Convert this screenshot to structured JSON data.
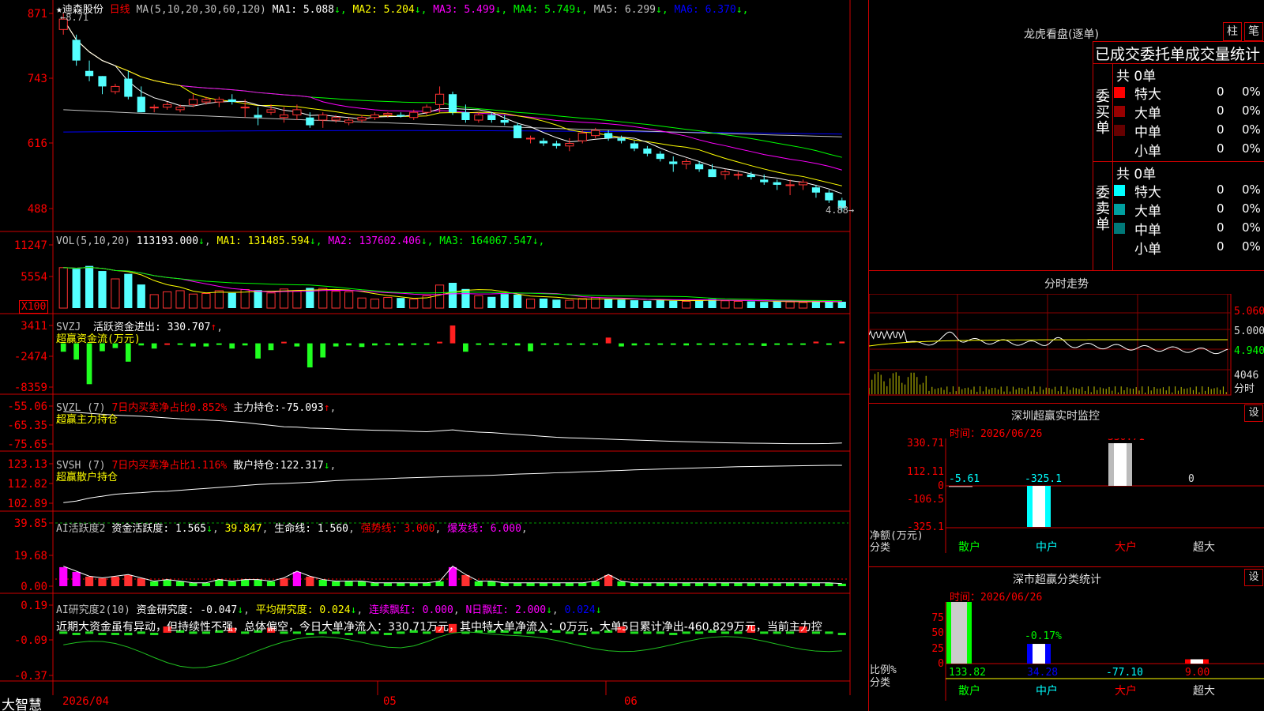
{
  "stock": {
    "star": "★",
    "name": "迪森股份",
    "period": "日线"
  },
  "ma_line": {
    "title": "MA(5,10,20,30,60,120)",
    "items": [
      {
        "label": "MA1:",
        "value": "5.088",
        "arrow": "↓",
        "color": "#ffffff"
      },
      {
        "label": "MA2:",
        "value": "5.204",
        "arrow": "↓",
        "color": "#ffff00"
      },
      {
        "label": "MA3:",
        "value": "5.499",
        "arrow": "↓",
        "color": "#ff00ff"
      },
      {
        "label": "MA4:",
        "value": "5.749",
        "arrow": "↓",
        "color": "#00ff00"
      },
      {
        "label": "MA5:",
        "value": "6.299",
        "arrow": "↓",
        "color": "#c0c0c0"
      },
      {
        "label": "MA6:",
        "value": "6.370",
        "arrow": "↓",
        "color": "#0000ff"
      }
    ]
  },
  "price_axis": [
    "871",
    "743",
    "616",
    "488"
  ],
  "price_high": "8.71",
  "price_low": "4.88",
  "vol": {
    "title": "VOL(5,10,20)",
    "value": "113193.000",
    "arrow": "↓",
    "items": [
      {
        "label": "MA1:",
        "value": "131485.594",
        "arrow": "↓",
        "color": "#ffff00"
      },
      {
        "label": "MA2:",
        "value": "137602.406",
        "arrow": "↓",
        "color": "#ff00ff"
      },
      {
        "label": "MA3:",
        "value": "164067.547",
        "arrow": "↓",
        "color": "#00ff00"
      }
    ],
    "axis": [
      "11247",
      "5554"
    ],
    "unit": "X100"
  },
  "svzj": {
    "name": "SVZJ",
    "label": "活跃资金进出:",
    "value": "330.707",
    "arrow": "↑",
    "sub": "超赢资金流(万元)",
    "axis": [
      "3411",
      "-2474",
      "-8359"
    ]
  },
  "svzl": {
    "name": "SVZL (7)",
    "label": "7日内买卖净占比0.852%",
    "label2": "主力持仓:",
    "value": "-75.093",
    "arrow": "↑",
    "sub": "超赢主力持仓",
    "axis": [
      "-55.06",
      "-65.35",
      "-75.65"
    ]
  },
  "svsh": {
    "name": "SVSH (7)",
    "label": "7日内买卖净占比1.116%",
    "label2": "散户持仓:",
    "value": "122.317",
    "arrow": "↓",
    "sub": "超赢散户持仓",
    "axis": [
      "123.13",
      "112.82",
      "102.89"
    ]
  },
  "ai_active": {
    "name": "AI活跃度2",
    "label": "资金活跃度:",
    "value": "1.565",
    "arrow": "↓",
    "v2": "39.847",
    "label3": "生命线:",
    "v3": "1.560",
    "label4": "强势线:",
    "v4": "3.000",
    "label5": "爆发线:",
    "v5": "6.000",
    "axis": [
      "39.85",
      "19.68",
      "0.00"
    ]
  },
  "ai_research": {
    "name": "AI研究度2(10)",
    "label": "资金研究度:",
    "value": "-0.047",
    "arrow": "↓",
    "label2": "平均研究度:",
    "v2": "0.024",
    "label3": "连续飘红:",
    "v3": "0.000",
    "label4": "N日飘红:",
    "v4": "2.000",
    "v5": "0.024",
    "text": "近期大资金虽有异动，但持续性不强，总体偏空，今日大单净流入：330.71万元，其中特大单净流入：0万元，大单5日累计净出-460.829万元，当前主力控",
    "axis": [
      "0.19",
      "-0.09",
      "-0.37"
    ]
  },
  "x_axis": [
    "2026/04",
    "05",
    "06"
  ],
  "footer_logo": "大智慧",
  "right": {
    "title": "龙虎看盘(逐单)",
    "btn_a": "柱",
    "btn_b": "笔",
    "header": "已成交委托单成交量统计",
    "buy": {
      "label": "委买单",
      "total": "共 0单",
      "rows": [
        {
          "color": "#ff0000",
          "name": "特大",
          "count": "0",
          "pct": "0%"
        },
        {
          "color": "#990000",
          "name": "大单",
          "count": "0",
          "pct": "0%"
        },
        {
          "color": "#660000",
          "name": "中单",
          "count": "0",
          "pct": "0%"
        },
        {
          "color": "",
          "name": "小单",
          "count": "0",
          "pct": "0%"
        }
      ]
    },
    "sell": {
      "label": "委卖单",
      "total": "共 0单",
      "rows": [
        {
          "color": "#00ffff",
          "name": "特大",
          "count": "0",
          "pct": "0%"
        },
        {
          "color": "#00a0a0",
          "name": "大单",
          "count": "0",
          "pct": "0%"
        },
        {
          "color": "#007878",
          "name": "中单",
          "count": "0",
          "pct": "0%"
        },
        {
          "color": "",
          "name": "小单",
          "count": "0",
          "pct": "0%"
        }
      ]
    },
    "intraday": {
      "title": "分时走势",
      "axis": [
        "5.060",
        "5.000",
        "4.940"
      ],
      "vol": "4046",
      "vol_label": "分时"
    },
    "monitor": {
      "title": "深圳超赢实时监控",
      "btn": "设",
      "time_label": "时间：",
      "time": "2026/06/26",
      "axis": [
        "330.71",
        "112.11",
        "0",
        "-106.5",
        "-325.1"
      ],
      "ylabel": "净额(万元)",
      "xlabel": "分类",
      "categories": [
        "散户",
        "中户",
        "大户",
        "超大"
      ],
      "values": [
        "-5.61",
        "-325.1",
        "330.71",
        "0"
      ]
    },
    "classify": {
      "title": "深市超赢分类统计",
      "btn": "设",
      "time_label": "时间：",
      "time": "2026/06/26",
      "axis": [
        "75",
        "50",
        "25",
        "0"
      ],
      "ylabel": "比例%",
      "xlabel": "分类",
      "top_value": "-0.17%",
      "categories": [
        "散户",
        "中户",
        "大户",
        "超大"
      ],
      "values": [
        "133.82",
        "34.28",
        "-77.10",
        "9.00"
      ]
    }
  },
  "chart_data": [
    {
      "type": "candlestick",
      "title": "迪森股份 日线",
      "ylim": [
        4.88,
        8.71
      ],
      "ohlc": [
        [
          8.4,
          8.71,
          8.3,
          8.6
        ],
        [
          8.2,
          8.3,
          7.7,
          7.8
        ],
        [
          7.6,
          7.8,
          7.4,
          7.5
        ],
        [
          7.5,
          7.5,
          7.15,
          7.3
        ],
        [
          7.2,
          7.35,
          7.15,
          7.3
        ],
        [
          7.45,
          7.6,
          7.05,
          7.1
        ],
        [
          7.1,
          7.3,
          6.8,
          6.8
        ],
        [
          6.9,
          6.95,
          6.8,
          6.9
        ],
        [
          6.9,
          7.0,
          6.85,
          6.95
        ],
        [
          6.85,
          6.95,
          6.8,
          6.9
        ],
        [
          6.95,
          7.15,
          6.9,
          7.05
        ],
        [
          7.0,
          7.1,
          6.95,
          7.05
        ],
        [
          7.0,
          7.1,
          6.9,
          7.05
        ],
        [
          7.05,
          7.15,
          6.95,
          7.0
        ],
        [
          6.9,
          7.05,
          6.7,
          6.9
        ],
        [
          6.75,
          6.9,
          6.55,
          6.7
        ],
        [
          6.8,
          6.95,
          6.75,
          6.85
        ],
        [
          6.7,
          6.9,
          6.6,
          6.75
        ],
        [
          6.75,
          6.95,
          6.65,
          6.85
        ],
        [
          6.7,
          6.8,
          6.5,
          6.55
        ],
        [
          6.65,
          6.8,
          6.5,
          6.75
        ],
        [
          6.65,
          6.75,
          6.6,
          6.7
        ],
        [
          6.6,
          6.7,
          6.55,
          6.65
        ],
        [
          6.65,
          6.75,
          6.6,
          6.7
        ],
        [
          6.7,
          6.8,
          6.65,
          6.75
        ],
        [
          6.75,
          6.8,
          6.7,
          6.78
        ],
        [
          6.75,
          6.8,
          6.7,
          6.72
        ],
        [
          6.7,
          6.85,
          6.65,
          6.8
        ],
        [
          6.8,
          6.95,
          6.75,
          6.9
        ],
        [
          6.95,
          7.3,
          6.8,
          7.15
        ],
        [
          7.15,
          7.2,
          6.75,
          6.8
        ],
        [
          6.8,
          6.95,
          6.6,
          6.65
        ],
        [
          6.65,
          6.8,
          6.6,
          6.75
        ],
        [
          6.75,
          6.8,
          6.6,
          6.65
        ],
        [
          6.65,
          6.75,
          6.55,
          6.6
        ],
        [
          6.55,
          6.6,
          6.3,
          6.3
        ],
        [
          6.3,
          6.35,
          6.2,
          6.3
        ],
        [
          6.25,
          6.3,
          6.15,
          6.2
        ],
        [
          6.2,
          6.25,
          6.1,
          6.15
        ],
        [
          6.15,
          6.3,
          6.05,
          6.2
        ],
        [
          6.25,
          6.45,
          6.2,
          6.4
        ],
        [
          6.35,
          6.5,
          6.3,
          6.45
        ],
        [
          6.4,
          6.45,
          6.25,
          6.3
        ],
        [
          6.3,
          6.35,
          6.2,
          6.25
        ],
        [
          6.2,
          6.25,
          6.05,
          6.1
        ],
        [
          6.1,
          6.15,
          5.95,
          6.0
        ],
        [
          6.0,
          6.05,
          5.85,
          5.9
        ],
        [
          5.85,
          5.95,
          5.65,
          5.8
        ],
        [
          5.8,
          5.9,
          5.7,
          5.85
        ],
        [
          5.8,
          5.85,
          5.65,
          5.7
        ],
        [
          5.7,
          5.8,
          5.55,
          5.55
        ],
        [
          5.6,
          5.7,
          5.5,
          5.65
        ],
        [
          5.6,
          5.65,
          5.5,
          5.6
        ],
        [
          5.6,
          5.65,
          5.5,
          5.55
        ],
        [
          5.5,
          5.6,
          5.4,
          5.45
        ],
        [
          5.45,
          5.5,
          5.3,
          5.4
        ],
        [
          5.4,
          5.5,
          5.2,
          5.4
        ],
        [
          5.4,
          5.5,
          5.3,
          5.45
        ],
        [
          5.35,
          5.4,
          5.15,
          5.25
        ],
        [
          5.25,
          5.3,
          5.05,
          5.1
        ],
        [
          5.1,
          5.15,
          4.88,
          4.95
        ]
      ],
      "ma_values": {
        "MA1": 5.088,
        "MA2": 5.204,
        "MA3": 5.499,
        "MA4": 5.749,
        "MA5": 6.299,
        "MA6": 6.37
      }
    },
    {
      "type": "bar",
      "title": "VOL(5,10,20)",
      "ylim": [
        0,
        11247
      ],
      "values": [
        7200,
        7000,
        7500,
        6600,
        5200,
        6100,
        4200,
        2400,
        2900,
        3100,
        2500,
        2600,
        3100,
        2700,
        3300,
        3200,
        2700,
        3400,
        3100,
        3600,
        3500,
        3000,
        2900,
        1800,
        1600,
        1900,
        1800,
        1600,
        2200,
        4100,
        4500,
        3400,
        2200,
        2000,
        2500,
        2400,
        1600,
        1700,
        1500,
        1400,
        1700,
        1900,
        1600,
        1500,
        1400,
        1300,
        1400,
        1300,
        1200,
        1500,
        1600,
        1300,
        1200,
        1200,
        1100,
        1200,
        1100,
        1000,
        1200,
        1100,
        1132
      ]
    },
    {
      "type": "bar",
      "title": "SVZJ 超赢资金流(万元)",
      "ylim": [
        -8359,
        3411
      ],
      "values": [
        -1600,
        -3100,
        -7800,
        -1500,
        -900,
        -3500,
        -400,
        -1000,
        0,
        -100,
        -600,
        -600,
        -300,
        -1000,
        -400,
        -2900,
        -1300,
        300,
        -600,
        -4600,
        -2700,
        -600,
        -400,
        -700,
        -400,
        -300,
        -400,
        -300,
        -300,
        300,
        3411,
        -1600,
        -300,
        -300,
        -300,
        -400,
        -1500,
        -200,
        -200,
        -200,
        -200,
        -200,
        1100,
        -600,
        -400,
        -300,
        -300,
        -200,
        -400,
        -300,
        -300,
        -200,
        -300,
        -300,
        -500,
        -200,
        -200,
        -300,
        330.707,
        -300,
        330.707
      ]
    },
    {
      "type": "line",
      "title": "SVZL 超赢主力持仓",
      "ylim": [
        -75.65,
        -55.06
      ],
      "values": [
        -58.0,
        -58.5,
        -59.0,
        -59.5,
        -60.0,
        -60.3,
        -60.6,
        -61.0,
        -61.5,
        -62.0,
        -62.3,
        -62.6,
        -63.0,
        -63.5,
        -64.0,
        -64.8,
        -65.5,
        -66.3,
        -66.5,
        -67.0,
        -67.2,
        -67.5,
        -67.8,
        -68.0,
        -68.2,
        -68.3,
        -68.5,
        -68.8,
        -69.0,
        -68.5,
        -68.0,
        -68.8,
        -69.2,
        -69.5,
        -70.0,
        -70.5,
        -71.0,
        -71.5,
        -72.0,
        -72.3,
        -72.5,
        -72.8,
        -73.0,
        -73.3,
        -73.5,
        -73.7,
        -74.0,
        -74.2,
        -74.4,
        -74.6,
        -74.8,
        -75.0,
        -75.1,
        -75.2,
        -75.3,
        -75.4,
        -75.5,
        -75.5,
        -75.5,
        -75.4,
        -75.093
      ]
    },
    {
      "type": "line",
      "title": "SVSH 超赢散户持仓",
      "ylim": [
        102.89,
        123.13
      ],
      "values": [
        103.2,
        104.0,
        105.5,
        106.5,
        107.5,
        108.0,
        108.3,
        108.8,
        109.0,
        109.5,
        110.0,
        110.5,
        111.0,
        111.5,
        112.0,
        112.5,
        112.8,
        113.0,
        113.3,
        113.6,
        114.0,
        114.5,
        114.8,
        115.0,
        115.3,
        115.5,
        115.8,
        116.0,
        116.2,
        116.4,
        116.6,
        116.8,
        117.0,
        117.2,
        117.5,
        117.8,
        118.0,
        118.2,
        118.5,
        118.7,
        119.0,
        119.2,
        119.5,
        119.7,
        120.0,
        120.2,
        120.4,
        120.6,
        120.8,
        121.0,
        121.2,
        121.4,
        121.6,
        121.7,
        121.8,
        121.9,
        122.0,
        122.1,
        122.2,
        122.3,
        122.317
      ]
    },
    {
      "type": "bar",
      "title": "AI活跃度2",
      "ylim": [
        0,
        39.85
      ],
      "values": [
        12,
        9,
        6,
        5,
        6,
        7,
        5,
        3,
        4,
        3,
        2,
        2,
        4,
        3,
        4,
        4,
        3,
        5,
        9,
        6,
        4,
        3,
        3,
        3,
        2,
        2,
        2,
        2,
        2,
        3,
        12,
        7,
        3,
        3,
        2,
        2,
        2,
        2,
        2,
        2,
        2,
        3,
        7,
        3,
        2,
        2,
        2,
        2,
        2,
        2,
        2,
        2,
        2,
        2,
        2,
        2,
        2,
        2,
        2,
        2,
        1.565
      ]
    },
    {
      "type": "bar",
      "title": "AI研究度2(10)",
      "ylim": [
        -0.37,
        0.19
      ],
      "values": [
        -0.02,
        -0.03,
        -0.02,
        -0.03,
        -0.04,
        -0.05,
        -0.02,
        -0.03,
        0.02,
        -0.01,
        -0.02,
        -0.02,
        -0.01,
        0.01,
        -0.02,
        -0.01,
        0.01,
        -0.02,
        -0.02,
        -0.03,
        -0.02,
        -0.02,
        -0.03,
        -0.02,
        -0.02,
        -0.03,
        -0.02,
        -0.01,
        -0.02,
        0.02,
        0.04,
        -0.02,
        -0.01,
        -0.01,
        -0.01,
        -0.02,
        -0.02,
        -0.01,
        -0.01,
        -0.02,
        -0.03,
        -0.02,
        -0.01,
        0.02,
        -0.02,
        -0.02,
        -0.02,
        -0.03,
        -0.02,
        -0.02,
        -0.01,
        -0.02,
        -0.02,
        0.03,
        -0.02,
        -0.02,
        -0.02,
        0.02,
        -0.02,
        -0.02,
        -0.047
      ]
    },
    {
      "type": "bar",
      "title": "深圳超赢实时监控",
      "categories": [
        "散户",
        "中户",
        "大户",
        "超大"
      ],
      "values": [
        -5.61,
        -325.1,
        330.71,
        0
      ],
      "ylim": [
        -325.1,
        330.71
      ]
    },
    {
      "type": "bar",
      "title": "深市超赢分类统计",
      "categories": [
        "散户",
        "中户",
        "大户",
        "超大"
      ],
      "values": [
        133.82,
        34.28,
        -77.1,
        9.0
      ],
      "ylim": [
        0,
        75
      ]
    }
  ]
}
